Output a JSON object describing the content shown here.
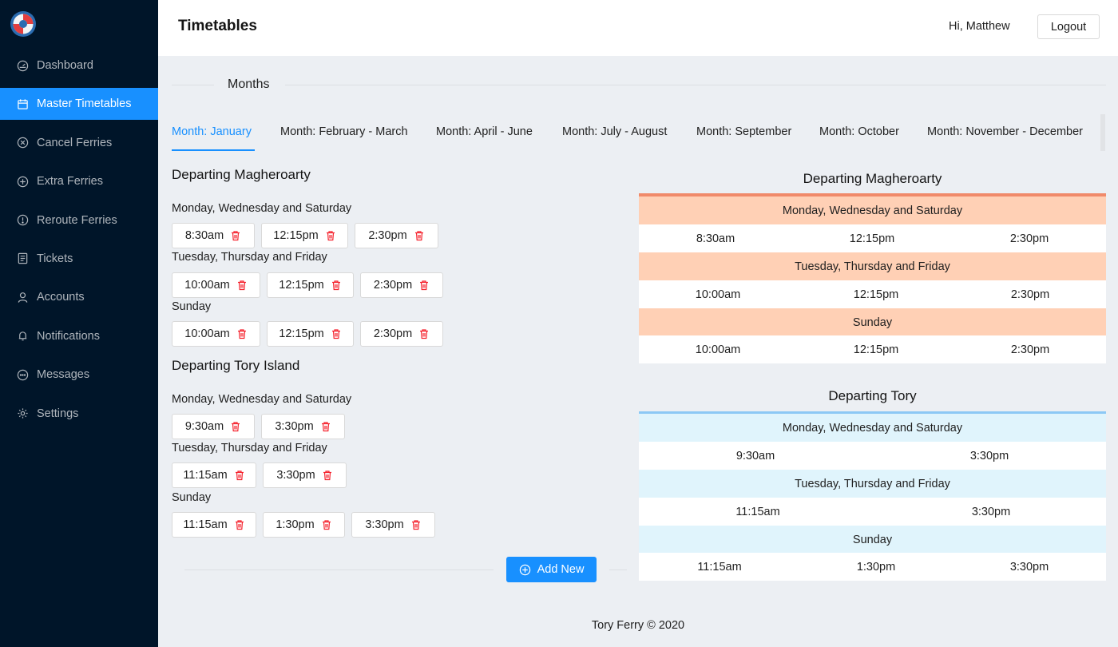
{
  "colors": {
    "sidebar_bg": "#001529",
    "accent": "#1890ff",
    "delete_icon": "#f5222d",
    "magheroarty_bar": "#f08a6a",
    "magheroarty_head": "#ffd0b5",
    "tory_bar": "#8cc8f5",
    "tory_head": "#e0f4fc"
  },
  "sidebar": {
    "items": [
      {
        "label": "Dashboard",
        "icon": "dashboard-icon"
      },
      {
        "label": "Master Timetables",
        "icon": "calendar-icon"
      },
      {
        "label": "Cancel Ferries",
        "icon": "close-circle-icon"
      },
      {
        "label": "Extra Ferries",
        "icon": "plus-circle-icon"
      },
      {
        "label": "Reroute Ferries",
        "icon": "exclamation-circle-icon"
      },
      {
        "label": "Tickets",
        "icon": "ticket-list-icon"
      },
      {
        "label": "Accounts",
        "icon": "user-icon"
      },
      {
        "label": "Notifications",
        "icon": "bell-icon"
      },
      {
        "label": "Messages",
        "icon": "message-icon"
      },
      {
        "label": "Settings",
        "icon": "gear-icon"
      }
    ]
  },
  "header": {
    "title": "Timetables",
    "greeting": "Hi, Matthew",
    "logout": "Logout"
  },
  "months": {
    "title": "Months",
    "tabs": [
      "Month: January",
      "Month: February - March",
      "Month: April - June",
      "Month: July - August",
      "Month: September",
      "Month: October",
      "Month: November - December"
    ]
  },
  "editor": {
    "magheroarty": {
      "title": "Departing Magheroarty",
      "groups": [
        {
          "day": "Monday, Wednesday and Saturday",
          "times": [
            "8:30am",
            "12:15pm",
            "2:30pm"
          ]
        },
        {
          "day": "Tuesday, Thursday and Friday",
          "times": [
            "10:00am",
            "12:15pm",
            "2:30pm"
          ]
        },
        {
          "day": "Sunday",
          "times": [
            "10:00am",
            "12:15pm",
            "2:30pm"
          ]
        }
      ]
    },
    "tory": {
      "title": "Departing Tory Island",
      "groups": [
        {
          "day": "Monday, Wednesday and Saturday",
          "times": [
            "9:30am",
            "3:30pm"
          ]
        },
        {
          "day": "Tuesday, Thursday and Friday",
          "times": [
            "11:15am",
            "3:30pm"
          ]
        },
        {
          "day": "Sunday",
          "times": [
            "11:15am",
            "1:30pm",
            "3:30pm"
          ]
        }
      ]
    },
    "add_new": "Add New"
  },
  "preview": {
    "magheroarty": {
      "title": "Departing Magheroarty",
      "groups": [
        {
          "day": "Monday, Wednesday and Saturday",
          "times": [
            "8:30am",
            "12:15pm",
            "2:30pm"
          ]
        },
        {
          "day": "Tuesday, Thursday and Friday",
          "times": [
            "10:00am",
            "12:15pm",
            "2:30pm"
          ]
        },
        {
          "day": "Sunday",
          "times": [
            "10:00am",
            "12:15pm",
            "2:30pm"
          ]
        }
      ]
    },
    "tory": {
      "title": "Departing Tory",
      "groups": [
        {
          "day": "Monday, Wednesday and Saturday",
          "times": [
            "9:30am",
            "3:30pm"
          ]
        },
        {
          "day": "Tuesday, Thursday and Friday",
          "times": [
            "11:15am",
            "3:30pm"
          ]
        },
        {
          "day": "Sunday",
          "times": [
            "11:15am",
            "1:30pm",
            "3:30pm"
          ]
        }
      ]
    }
  },
  "footer": "Tory Ferry © 2020"
}
